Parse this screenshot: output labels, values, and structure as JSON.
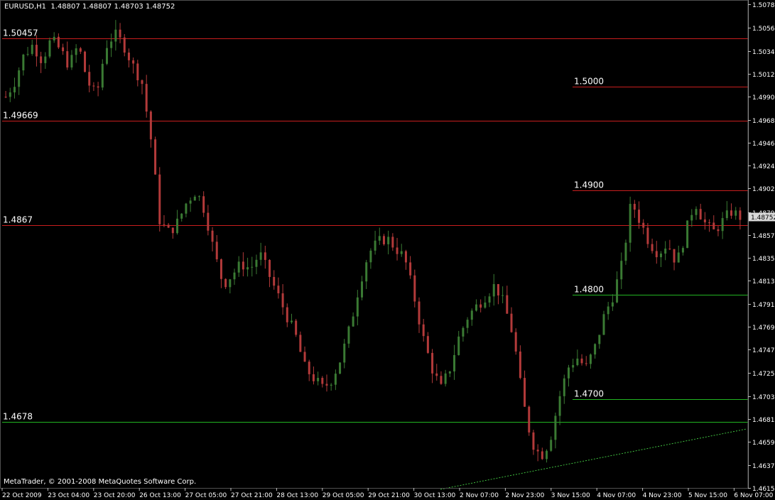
{
  "header": {
    "symbol": "EURUSD,H1",
    "ohlc": "1.48807 1.48807 1.48703 1.48752"
  },
  "footer": {
    "copyright": "MetaTrader, © 2001-2008 MetaQuotes Software Corp."
  },
  "colors": {
    "background": "#000000",
    "axis": "#c0c0c0",
    "bull": "#3a7a33",
    "bear": "#b33a3a",
    "resistance": "#c81e1e",
    "support": "#22b422",
    "trend": "#3fbf3f"
  },
  "chart_data": {
    "type": "candlestick",
    "ylim": [
      1.4615,
      1.5078
    ],
    "price_ticks": [
      "1.50785",
      "1.50565",
      "1.50340",
      "1.50120",
      "1.49900",
      "1.49680",
      "1.49460",
      "1.49240",
      "1.49020",
      "1.48795",
      "1.48575",
      "1.48355",
      "1.48135",
      "1.47915",
      "1.47695",
      "1.47475",
      "1.47255",
      "1.47030",
      "1.46810",
      "1.46590",
      "1.46370",
      "1.46150"
    ],
    "current_price": "1.48752",
    "time_labels": [
      "22 Oct 2009",
      "23 Oct 04:00",
      "23 Oct 20:00",
      "26 Oct 13:00",
      "27 Oct 05:00",
      "27 Oct 21:00",
      "28 Oct 13:00",
      "29 Oct 05:00",
      "29 Oct 21:00",
      "30 Oct 13:00",
      "2 Nov 07:00",
      "2 Nov 23:00",
      "3 Nov 15:00",
      "4 Nov 07:00",
      "4 Nov 23:00",
      "5 Nov 15:00",
      "6 Nov 07:00"
    ],
    "full_lines": [
      {
        "label": "1.50457",
        "value": 1.50457,
        "color": "resistance"
      },
      {
        "label": "1.49669",
        "value": 1.49669,
        "color": "resistance"
      },
      {
        "label": "1.4867",
        "value": 1.4867,
        "color": "resistance"
      },
      {
        "label": "1.4678",
        "value": 1.4678,
        "color": "support"
      }
    ],
    "level_lines": [
      {
        "label": "1.5000",
        "value": 1.5,
        "color": "resistance"
      },
      {
        "label": "1.4900",
        "value": 1.49,
        "color": "resistance"
      },
      {
        "label": "1.4800",
        "value": 1.48,
        "color": "support"
      },
      {
        "label": "1.4700",
        "value": 1.47,
        "color": "support"
      }
    ],
    "close_path": [
      1.499,
      1.5005,
      1.503,
      1.504,
      1.5025,
      1.5045,
      1.5035,
      1.502,
      1.504,
      1.5005,
      1.499,
      1.5038,
      1.505,
      1.504,
      1.502,
      1.5005,
      1.495,
      1.487,
      1.486,
      1.487,
      1.489,
      1.49,
      1.488,
      1.484,
      1.481,
      1.482,
      1.483,
      1.4825,
      1.484,
      1.482,
      1.48,
      1.478,
      1.476,
      1.473,
      1.472,
      1.471,
      1.472,
      1.474,
      1.477,
      1.481,
      1.484,
      1.485,
      1.4855,
      1.4845,
      1.4835,
      1.48,
      1.476,
      1.473,
      1.471,
      1.473,
      1.476,
      1.478,
      1.479,
      1.48,
      1.481,
      1.479,
      1.476,
      1.47,
      1.466,
      1.4645,
      1.466,
      1.47,
      1.473,
      1.474,
      1.473,
      1.475,
      1.478,
      1.48,
      1.483,
      1.489,
      1.487,
      1.485,
      1.484,
      1.485,
      1.483,
      1.486,
      1.489,
      1.487,
      1.486,
      1.487,
      1.488,
      1.4875
    ]
  }
}
